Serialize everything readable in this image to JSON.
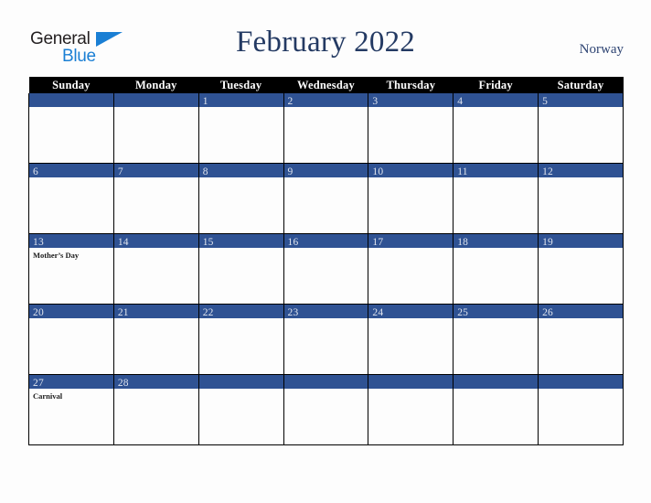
{
  "brand": {
    "name_part1": "General",
    "name_part2": "Blue"
  },
  "header": {
    "title": "February 2022",
    "country": "Norway"
  },
  "calendar": {
    "day_headers": [
      "Sunday",
      "Monday",
      "Tuesday",
      "Wednesday",
      "Thursday",
      "Friday",
      "Saturday"
    ],
    "colors": {
      "day_bar": "#2f5293",
      "header_bar": "#000000",
      "title": "#243a63",
      "brand_blue": "#1a7fd4"
    },
    "weeks": [
      [
        {
          "day": "",
          "events": []
        },
        {
          "day": "",
          "events": []
        },
        {
          "day": "1",
          "events": []
        },
        {
          "day": "2",
          "events": []
        },
        {
          "day": "3",
          "events": []
        },
        {
          "day": "4",
          "events": []
        },
        {
          "day": "5",
          "events": []
        }
      ],
      [
        {
          "day": "6",
          "events": []
        },
        {
          "day": "7",
          "events": []
        },
        {
          "day": "8",
          "events": []
        },
        {
          "day": "9",
          "events": []
        },
        {
          "day": "10",
          "events": []
        },
        {
          "day": "11",
          "events": []
        },
        {
          "day": "12",
          "events": []
        }
      ],
      [
        {
          "day": "13",
          "events": [
            "Mother’s Day"
          ]
        },
        {
          "day": "14",
          "events": []
        },
        {
          "day": "15",
          "events": []
        },
        {
          "day": "16",
          "events": []
        },
        {
          "day": "17",
          "events": []
        },
        {
          "day": "18",
          "events": []
        },
        {
          "day": "19",
          "events": []
        }
      ],
      [
        {
          "day": "20",
          "events": []
        },
        {
          "day": "21",
          "events": []
        },
        {
          "day": "22",
          "events": []
        },
        {
          "day": "23",
          "events": []
        },
        {
          "day": "24",
          "events": []
        },
        {
          "day": "25",
          "events": []
        },
        {
          "day": "26",
          "events": []
        }
      ],
      [
        {
          "day": "27",
          "events": [
            "Carnival"
          ]
        },
        {
          "day": "28",
          "events": []
        },
        {
          "day": "",
          "events": []
        },
        {
          "day": "",
          "events": []
        },
        {
          "day": "",
          "events": []
        },
        {
          "day": "",
          "events": []
        },
        {
          "day": "",
          "events": []
        }
      ]
    ]
  }
}
